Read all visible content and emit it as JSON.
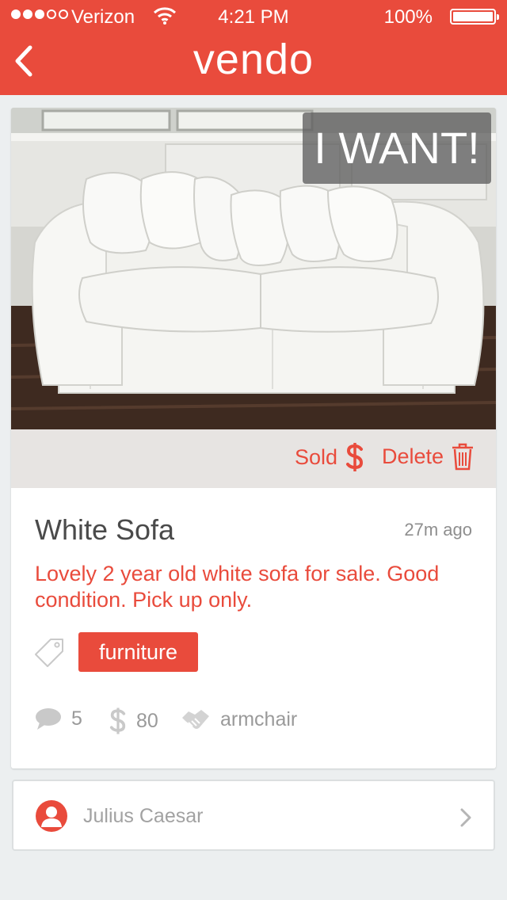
{
  "status_bar": {
    "carrier": "Verizon",
    "time": "4:21 PM",
    "battery_percent": "100%",
    "battery_level": 1.0,
    "signal_bars_filled": 3,
    "signal_bars_total": 5
  },
  "header": {
    "title": "vendo",
    "back_icon": "chevron-left-icon"
  },
  "listing": {
    "image_alt": "White sofa photo",
    "want_label": "I WANT!",
    "actions": {
      "sold_label": "Sold",
      "sold_icon": "dollar-icon",
      "delete_label": "Delete",
      "delete_icon": "trash-icon"
    },
    "title": "White Sofa",
    "posted_ago": "27m ago",
    "description": "Lovely 2 year old white sofa for sale. Good condition. Pick up only.",
    "tag_icon": "tag-icon",
    "tags": [
      "furniture"
    ],
    "stats": {
      "comments_count": "5",
      "price": "80",
      "trade_for": "armchair"
    }
  },
  "seller": {
    "name": "Julius Caesar",
    "avatar_icon": "user-icon",
    "chevron_icon": "chevron-right-icon"
  },
  "colors": {
    "accent": "#e94b3c",
    "background": "#eceff0",
    "muted_text": "#9a9a9a"
  }
}
